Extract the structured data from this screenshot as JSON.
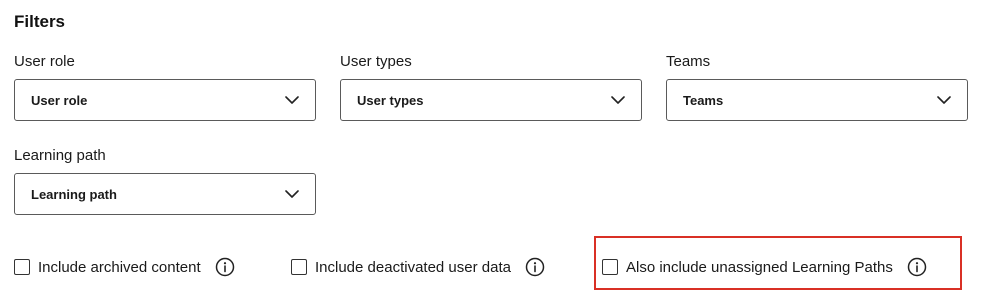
{
  "filters": {
    "heading": "Filters",
    "user_role": {
      "label": "User role",
      "value": "User role"
    },
    "user_types": {
      "label": "User types",
      "value": "User types"
    },
    "teams": {
      "label": "Teams",
      "value": "Teams"
    },
    "learning_path": {
      "label": "Learning path",
      "value": "Learning path"
    }
  },
  "options": {
    "archived": {
      "label": "Include archived content",
      "checked": false
    },
    "deactivated": {
      "label": "Include deactivated user data",
      "checked": false
    },
    "unassigned": {
      "label": "Also include unassigned Learning Paths",
      "checked": false
    }
  },
  "colors": {
    "highlight": "#d93025",
    "border": "#5a5a5a",
    "text": "#1a1a1a"
  }
}
